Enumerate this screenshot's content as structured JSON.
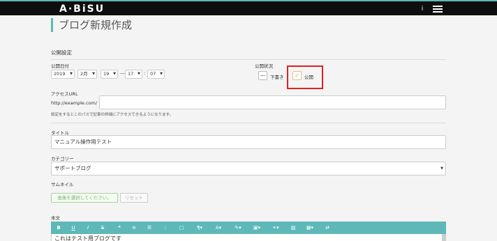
{
  "app": {
    "logo": "A·BiSU"
  },
  "header": {
    "info_icon": "i",
    "menu_icon": "hamburger-icon"
  },
  "page": {
    "title": "ブログ新規作成"
  },
  "publish_settings": {
    "section_title": "公開設定",
    "date_label": "公開日付",
    "year": "2019",
    "month": "2月",
    "day": "19",
    "dash": "—",
    "hour": "17",
    "colon": ":",
    "minute": "07",
    "status_label": "公開状況",
    "draft_label": "下書き",
    "public_label": "公開",
    "draft_symbol": "—",
    "public_symbol": "✓"
  },
  "access_url": {
    "label": "アクセスURL",
    "prefix": "http://example.com/",
    "value": "",
    "help": "設定をするとこのパスで記事の詳細にアクセスできるようになります。"
  },
  "title_field": {
    "label": "タイトル",
    "value": "マニュアル操作用テスト"
  },
  "category": {
    "label": "カテゴリー",
    "value": "サポートブログ"
  },
  "thumbnail": {
    "label": "サムネイル",
    "select_button": "画像を選択してください。",
    "reset_button": "リセット"
  },
  "body": {
    "label": "本文",
    "content": "これはテスト用ブログです",
    "toolbar": [
      "B",
      "U",
      "I",
      "S",
      "❝",
      "≡",
      "☰",
      "⋮",
      "▢",
      "¶▾",
      "A▾",
      "✎▾",
      "▣▾",
      "⚭▾",
      "▨",
      "▦▾",
      "⇄"
    ]
  },
  "colors": {
    "accent": "#5cb8b4",
    "highlight": "#e02020",
    "topbar": "#0e0e0e"
  }
}
